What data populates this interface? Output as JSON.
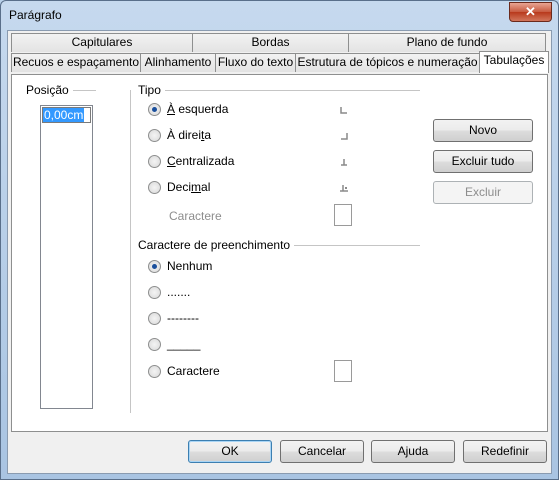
{
  "window": {
    "title": "Parágrafo",
    "close_label": "✕"
  },
  "tabs": {
    "row1": [
      "Capitulares",
      "Bordas",
      "Plano de fundo"
    ],
    "row2": [
      "Recuos e espaçamento",
      "Alinhamento",
      "Fluxo do texto",
      "Estrutura de tópicos e numeração",
      "Tabulações"
    ]
  },
  "position": {
    "label": "Posição",
    "value": "0,00cm"
  },
  "type": {
    "label": "Tipo",
    "options": [
      {
        "pre": "",
        "ul": "À",
        "post": " esquerda",
        "checked": true
      },
      {
        "pre": "À direi",
        "ul": "t",
        "post": "a",
        "checked": false
      },
      {
        "pre": "",
        "ul": "C",
        "post": "entralizada",
        "checked": false
      },
      {
        "pre": "Deci",
        "ul": "m",
        "post": "al",
        "checked": false
      }
    ],
    "char_label": "Caractere"
  },
  "fill": {
    "label": "Caractere de preenchimento",
    "options": [
      {
        "text": "Nenhum",
        "checked": true
      },
      {
        "text": ".......",
        "checked": false
      },
      {
        "text": "--------",
        "checked": false
      },
      {
        "text": "_____",
        "checked": false
      },
      {
        "text": "Caractere",
        "checked": false
      }
    ]
  },
  "side_buttons": {
    "new": "Novo",
    "delete_all": "Excluir tudo",
    "delete": "Excluir"
  },
  "bottom_buttons": {
    "ok": "OK",
    "cancel": "Cancelar",
    "help": "Ajuda",
    "reset": "Redefinir"
  }
}
